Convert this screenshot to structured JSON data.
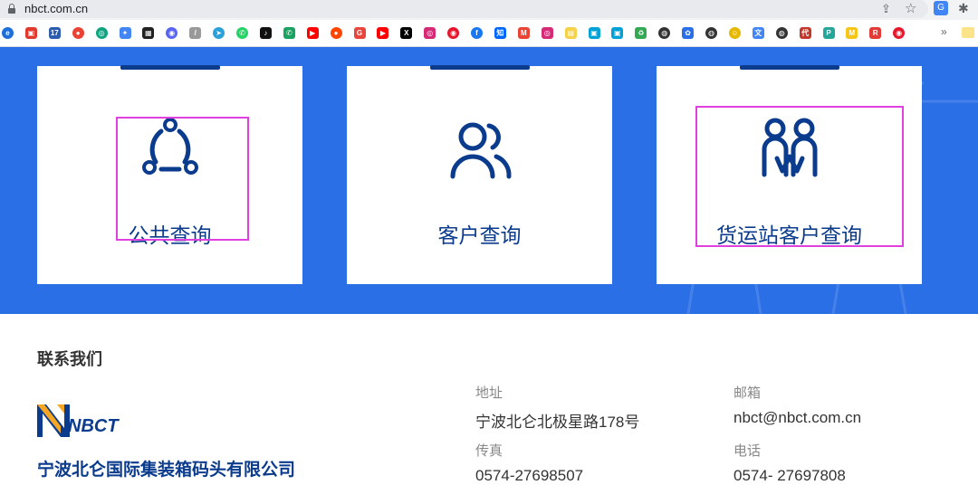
{
  "browser": {
    "url": "nbct.com.cn",
    "bookmark_icons": [
      {
        "name": "ie-icon",
        "color": "#1e6fd9",
        "glyph": "e"
      },
      {
        "name": "red-box-icon",
        "color": "#e03a2f",
        "glyph": "▣"
      },
      {
        "name": "seventeen-icon",
        "color": "#2a5db0",
        "glyph": "17"
      },
      {
        "name": "maps-pin-icon",
        "color": "#ea4335",
        "glyph": "●"
      },
      {
        "name": "chatgpt-icon",
        "color": "#10a37f",
        "glyph": "◎"
      },
      {
        "name": "gemini-icon",
        "color": "#4285f4",
        "glyph": "✦"
      },
      {
        "name": "tv-icon",
        "color": "#222222",
        "glyph": "▦"
      },
      {
        "name": "discord-icon",
        "color": "#5865f2",
        "glyph": "◉"
      },
      {
        "name": "signal-icon",
        "color": "#999999",
        "glyph": "/"
      },
      {
        "name": "telegram-icon",
        "color": "#2aa1da",
        "glyph": "➤"
      },
      {
        "name": "whatsapp-icon",
        "color": "#25d366",
        "glyph": "✆"
      },
      {
        "name": "tiktok-icon",
        "color": "#111111",
        "glyph": "♪"
      },
      {
        "name": "phone-icon",
        "color": "#1aa260",
        "glyph": "✆"
      },
      {
        "name": "youtube-icon",
        "color": "#ff0000",
        "glyph": "▶"
      },
      {
        "name": "reddit-icon",
        "color": "#ff4500",
        "glyph": "●"
      },
      {
        "name": "g-icon",
        "color": "#e8453c",
        "glyph": "G"
      },
      {
        "name": "youtube-2-icon",
        "color": "#ff0000",
        "glyph": "▶"
      },
      {
        "name": "x-icon",
        "color": "#000000",
        "glyph": "X"
      },
      {
        "name": "instagram-icon",
        "color": "#d62976",
        "glyph": "◎"
      },
      {
        "name": "weibo-icon",
        "color": "#e6162d",
        "glyph": "◉"
      },
      {
        "name": "facebook-icon",
        "color": "#1877f2",
        "glyph": "f"
      },
      {
        "name": "zhihu-icon",
        "color": "#0066ff",
        "glyph": "知"
      },
      {
        "name": "gmail-icon",
        "color": "#ea4335",
        "glyph": "M"
      },
      {
        "name": "instagram-2-icon",
        "color": "#d62976",
        "glyph": "◎"
      },
      {
        "name": "note-icon",
        "color": "#f7d14a",
        "glyph": "▤"
      },
      {
        "name": "bilibili-icon",
        "color": "#00a1d6",
        "glyph": "▣"
      },
      {
        "name": "bilibili-2-icon",
        "color": "#00a1d6",
        "glyph": "▣"
      },
      {
        "name": "recycle-icon",
        "color": "#34a853",
        "glyph": "♻"
      },
      {
        "name": "globe-icon",
        "color": "#333333",
        "glyph": "◍"
      },
      {
        "name": "paw-icon",
        "color": "#2a6fe6",
        "glyph": "✿"
      },
      {
        "name": "globe-2-icon",
        "color": "#333333",
        "glyph": "◍"
      },
      {
        "name": "emoji-icon",
        "color": "#e6b800",
        "glyph": "☺"
      },
      {
        "name": "translate-icon",
        "color": "#4285f4",
        "glyph": "文"
      },
      {
        "name": "globe-3-icon",
        "color": "#333333",
        "glyph": "◍"
      },
      {
        "name": "badge-icon",
        "color": "#c0392b",
        "glyph": "代"
      },
      {
        "name": "p-icon",
        "color": "#26a69a",
        "glyph": "P"
      },
      {
        "name": "mail-icon",
        "color": "#f5c518",
        "glyph": "M"
      },
      {
        "name": "r-icon",
        "color": "#e53935",
        "glyph": "R"
      },
      {
        "name": "weibo-2-icon",
        "color": "#e6162d",
        "glyph": "◉"
      }
    ],
    "more_label": "»"
  },
  "hero": {
    "bg_color": "#2a6fe6",
    "accent_color": "#0b3b8c",
    "cards": [
      {
        "label": "公共查询",
        "icon": "share-network-icon",
        "highlighted": true
      },
      {
        "label": "客户查询",
        "icon": "users-icon",
        "highlighted": false
      },
      {
        "label": "货运站客户查询",
        "icon": "people-link-icon",
        "highlighted": true
      }
    ]
  },
  "contact": {
    "title": "联系我们",
    "logo_text": "NBCT",
    "company_name": "宁波北仑国际集装箱码头有限公司",
    "address_label": "地址",
    "address_value": "宁波北仑北极星路178号",
    "email_label": "邮箱",
    "email_value": "nbct@nbct.com.cn",
    "fax_label": "传真",
    "fax_value": "0574-27698507",
    "phone_label": "电话",
    "phone_value": "0574- 27697808"
  }
}
